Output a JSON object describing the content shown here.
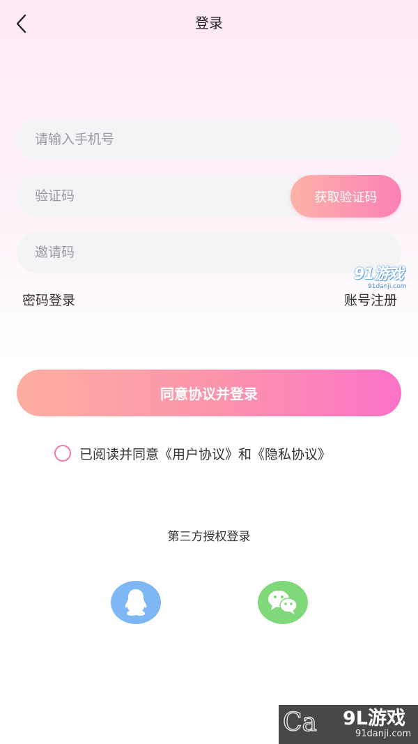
{
  "header": {
    "title": "登录",
    "back_icon": "chevron-left-icon"
  },
  "form": {
    "phone": {
      "placeholder": "请输入手机号",
      "value": ""
    },
    "code": {
      "placeholder": "验证码",
      "value": ""
    },
    "get_code_label": "获取验证码",
    "invite": {
      "placeholder": "邀请码",
      "value": ""
    },
    "password_login_label": "密码登录",
    "register_label": "账号注册",
    "submit_label": "同意协议并登录",
    "agreement": {
      "checked": false,
      "text": "已阅读并同意《用户协议》和《隐私协议》"
    }
  },
  "third_party": {
    "title": "第三方授权登录",
    "providers": [
      {
        "icon": "qq-icon",
        "color": "#7fb7f4"
      },
      {
        "icon": "wechat-icon",
        "color": "#7fd87a"
      }
    ]
  },
  "watermarks": {
    "top": {
      "mark": "91游戏",
      "url": "91danji.com"
    },
    "bottom": {
      "mark": "9L游戏",
      "url": "91danji.com",
      "letters": "Ca"
    }
  },
  "colors": {
    "accent_start": "#fdaea0",
    "accent_end": "#fb73c8",
    "checkbox_border": "#f27a9b"
  }
}
